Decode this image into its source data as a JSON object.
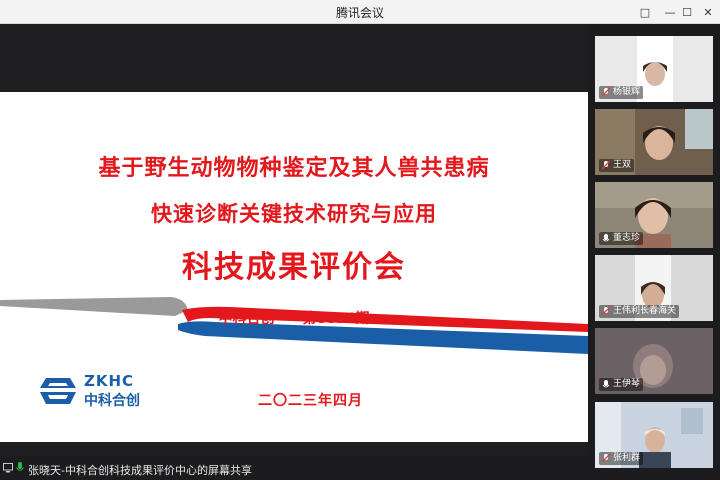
{
  "window": {
    "title": "腾讯会议"
  },
  "window_controls": {
    "pin": "□",
    "minimize": "—",
    "maximize": "☐",
    "close": "✕"
  },
  "slide": {
    "line1": "基于野生动物物种鉴定及其人兽共患病",
    "line2": "快速诊断关键技术研究与应用",
    "line3": "科技成果评价会",
    "org": "中科合创",
    "issue": "第8894期",
    "date": "二〇二三年四月",
    "logo_en": "ZKHC",
    "logo_cn": "中科合创"
  },
  "participants": [
    {
      "name": "杨银辉",
      "bg": "#e9e9ea",
      "muted": true
    },
    {
      "name": "王双",
      "bg": "#7b6a55",
      "muted": true
    },
    {
      "name": "董志珍",
      "bg": "#8d8676",
      "muted": false
    },
    {
      "name": "王伟利长春海关",
      "bg": "#d9d9da",
      "muted": true
    },
    {
      "name": "王伊琴",
      "bg": "#6c6265",
      "muted": false
    },
    {
      "name": "张利群",
      "bg": "#c9d4e0",
      "muted": true
    }
  ],
  "share_status": {
    "text": "张晓天-中科合创科技成果评价中心的屏幕共享"
  },
  "colors": {
    "title_red": "#e3181d",
    "brand_blue": "#1b5ea8",
    "stripe_red": "#e3181d"
  }
}
